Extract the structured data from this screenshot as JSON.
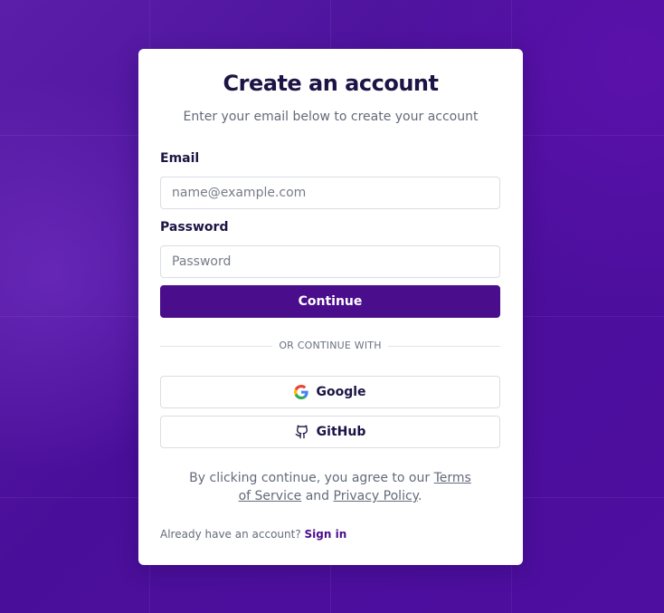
{
  "card": {
    "title": "Create an account",
    "subtitle": "Enter your email below to create your account"
  },
  "email": {
    "label": "Email",
    "placeholder": "name@example.com",
    "value": ""
  },
  "password": {
    "label": "Password",
    "placeholder": "Password",
    "value": ""
  },
  "continue_label": "Continue",
  "divider_text": "OR CONTINUE WITH",
  "oauth": {
    "google_label": "Google",
    "github_label": "GitHub"
  },
  "terms": {
    "prefix": "By clicking continue, you agree to our ",
    "terms_link": "Terms of Service",
    "middle": " and ",
    "privacy_link": "Privacy Policy",
    "suffix": "."
  },
  "signin": {
    "prompt": "Already have an account? ",
    "link": "Sign in"
  },
  "colors": {
    "background": "#4a0f9a",
    "primary": "#4a0d8c",
    "heading": "#1c1445",
    "muted": "#646a7a"
  }
}
